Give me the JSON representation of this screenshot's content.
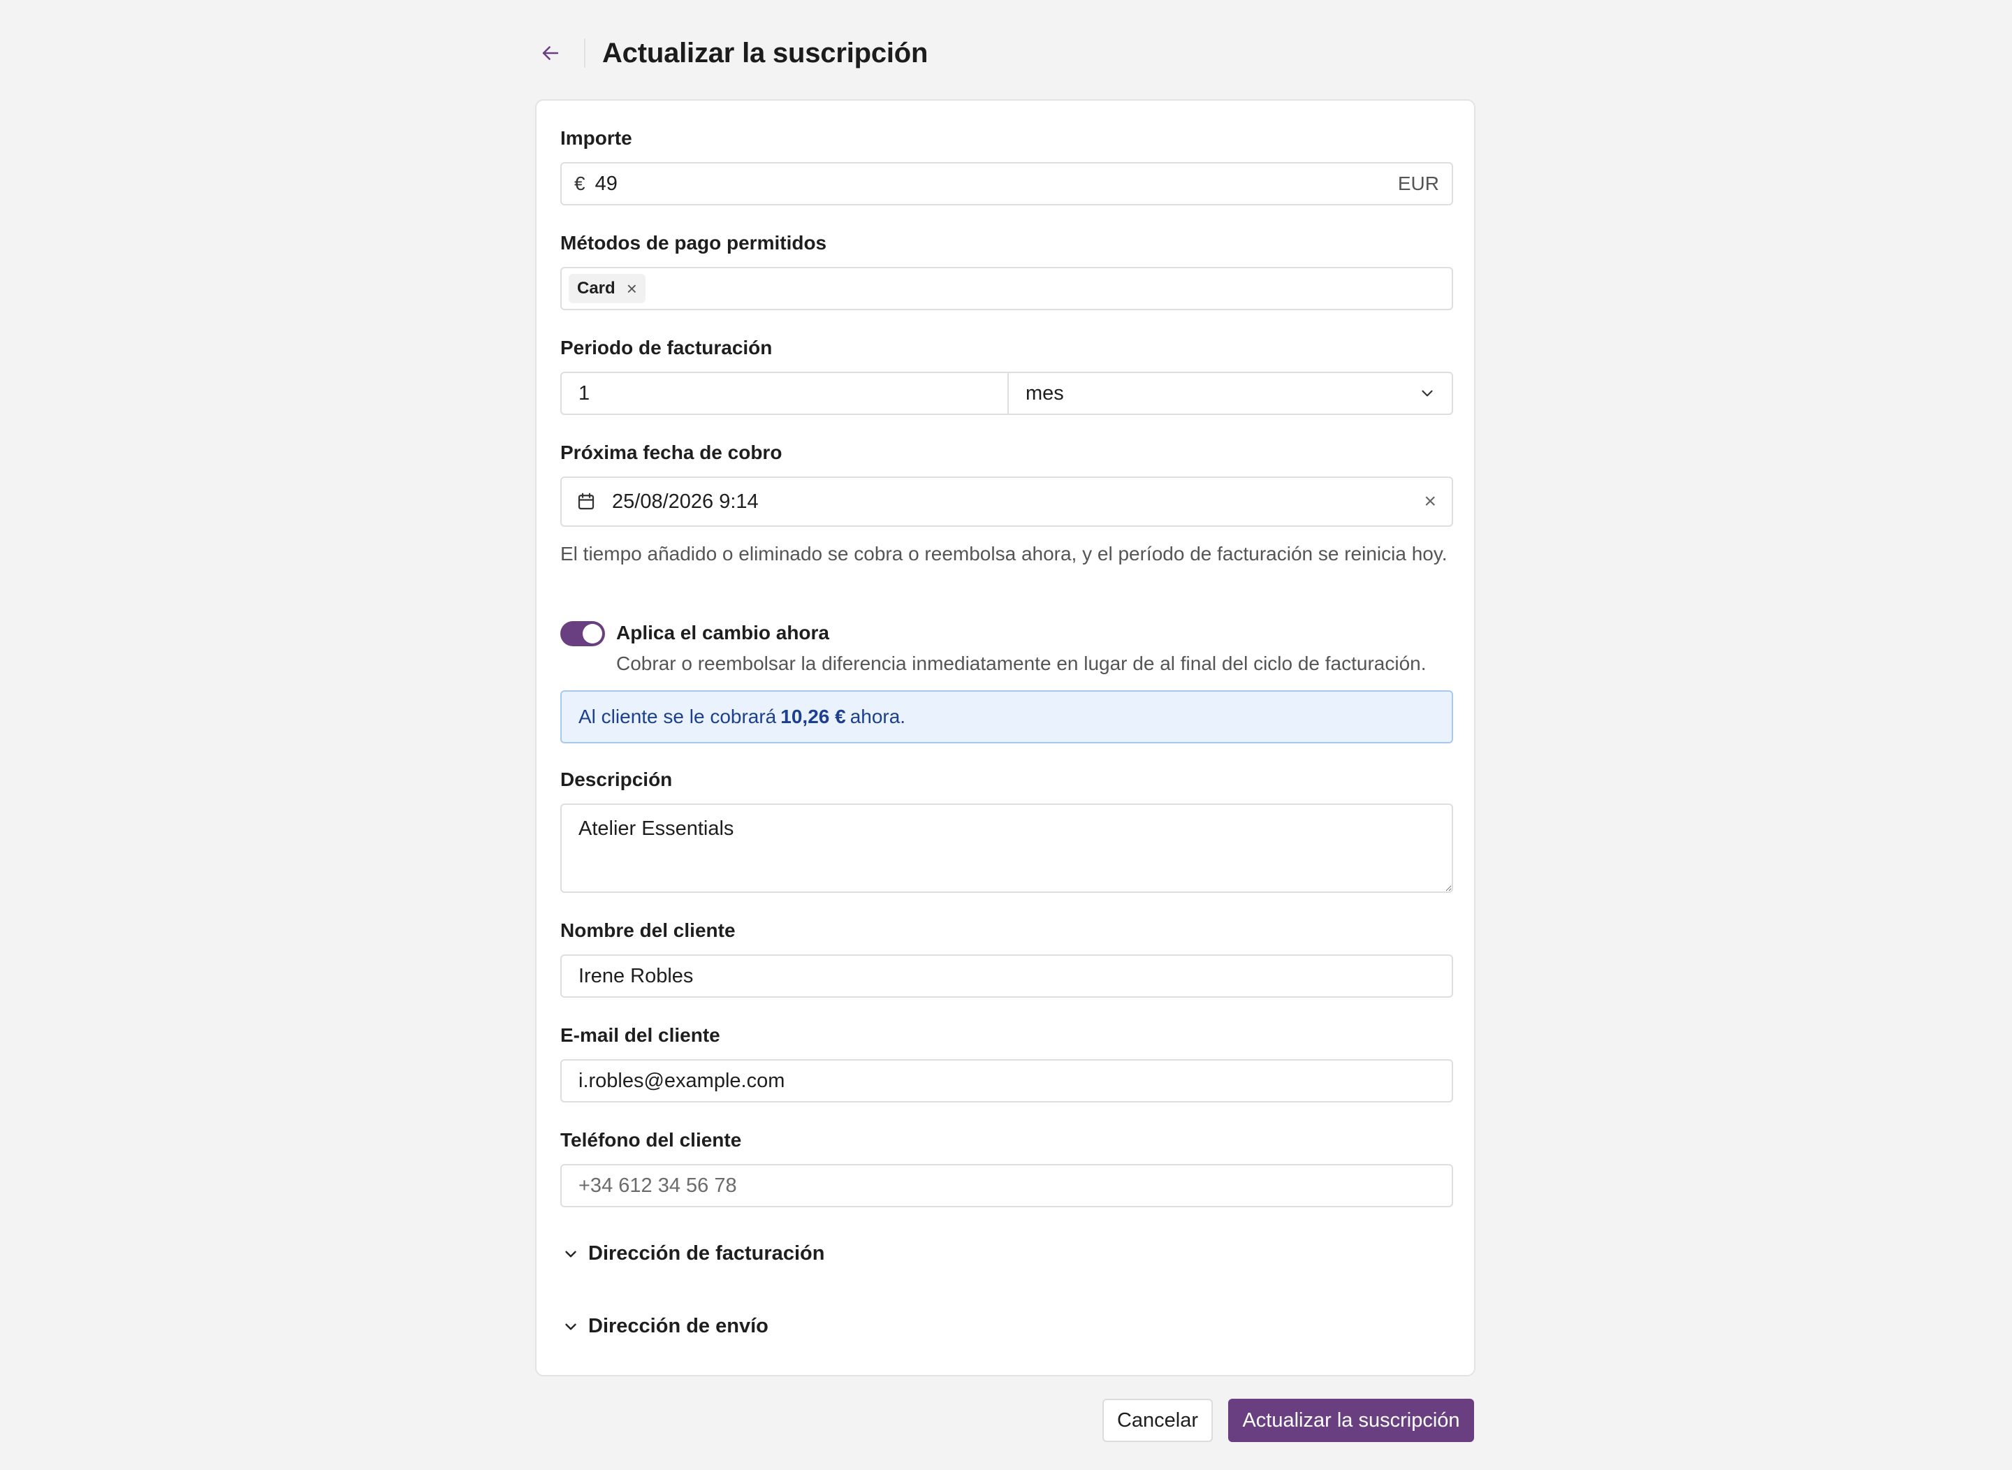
{
  "header": {
    "back_icon": "arrow-left-icon",
    "title": "Actualizar la suscripción"
  },
  "form": {
    "amount": {
      "label": "Importe",
      "prefix": "€",
      "value": "49",
      "currency": "EUR"
    },
    "payment_methods": {
      "label": "Métodos de pago permitidos",
      "chips": [
        "Card"
      ],
      "remove_glyph": "×"
    },
    "billing_period": {
      "label": "Periodo de facturación",
      "count": "1",
      "unit": "mes"
    },
    "next_charge": {
      "label": "Próxima fecha de cobro",
      "value": "25/08/2026 9:14",
      "clear_glyph": "×"
    },
    "help_text": "El tiempo añadido o eliminado se cobra o reembolsa ahora, y el período de facturación se reinicia hoy.",
    "apply_now": {
      "on": true,
      "label": "Aplica el cambio ahora",
      "description": "Cobrar o reembolsar la diferencia inmediatamente en lugar de al final del ciclo de facturación."
    },
    "notice": {
      "prefix": "Al cliente se le cobrará",
      "amount": "10,26 €",
      "suffix": "ahora."
    },
    "description": {
      "label": "Descripción",
      "value": "Atelier Essentials"
    },
    "customer_name": {
      "label": "Nombre del cliente",
      "value": "Irene Robles"
    },
    "customer_email": {
      "label": "E-mail del cliente",
      "value": "i.robles@example.com"
    },
    "customer_phone": {
      "label": "Teléfono del cliente",
      "placeholder": "+34 612 34 56 78",
      "value": ""
    },
    "billing_address": {
      "label": "Dirección de facturación",
      "expanded": false
    },
    "shipping_address": {
      "label": "Dirección de envío",
      "expanded": false
    }
  },
  "footer": {
    "cancel_label": "Cancelar",
    "submit_label": "Actualizar la suscripción"
  },
  "colors": {
    "accent": "#6a3f82",
    "notice_bg": "#eaf3fd",
    "notice_border": "#a8c9ef",
    "notice_text": "#1c3f8f",
    "page_bg": "#f3f3f3"
  }
}
